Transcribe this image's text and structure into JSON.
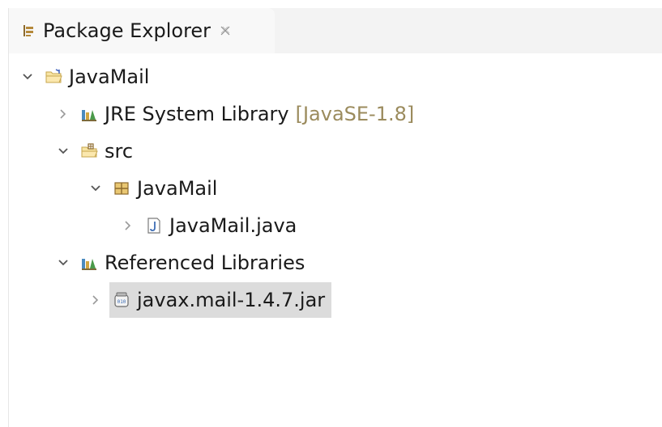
{
  "view": {
    "title": "Package Explorer",
    "title_icon": "package-explorer-icon",
    "close_icon": "close-icon"
  },
  "tree": {
    "project": {
      "label": "JavaMail",
      "expanded": true,
      "icon": "open-project-folder-icon"
    },
    "jre": {
      "label": "JRE System Library",
      "decoration": "[JavaSE-1.8]",
      "expanded": false,
      "icon": "library-icon"
    },
    "src": {
      "label": "src",
      "expanded": true,
      "icon": "source-folder-icon"
    },
    "package": {
      "label": "JavaMail",
      "expanded": true,
      "icon": "package-icon"
    },
    "java_file": {
      "label": "JavaMail.java",
      "expanded": false,
      "icon": "java-file-icon"
    },
    "referenced": {
      "label": "Referenced Libraries",
      "expanded": true,
      "icon": "library-icon"
    },
    "jar": {
      "label": "javax.mail-1.4.7.jar",
      "expanded": false,
      "selected": true,
      "icon": "jar-file-icon"
    }
  },
  "colors": {
    "header_bg": "#f3f3f3",
    "tab_bg": "#f8f8f8",
    "selection_bg": "#dcdcdc",
    "decoration_text": "#9b8b5d"
  }
}
